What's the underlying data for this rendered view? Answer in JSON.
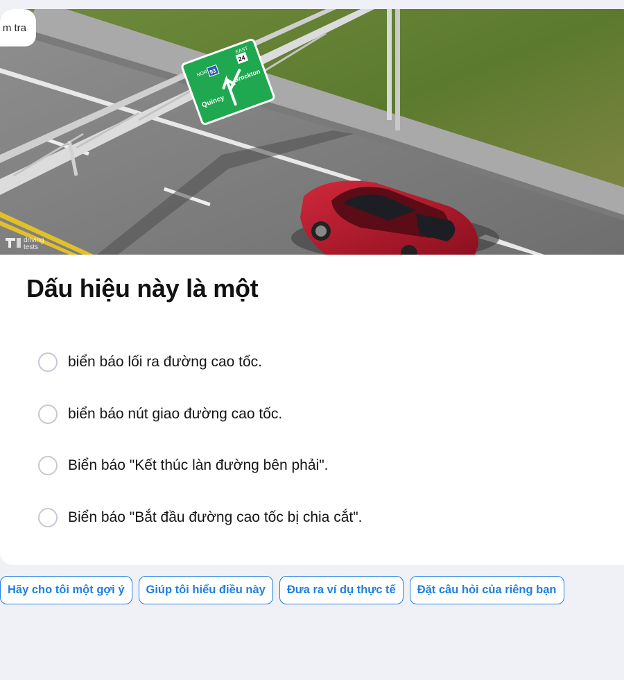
{
  "badge": {
    "text": "m tra"
  },
  "image": {
    "sign": {
      "north_label": "NORTH",
      "route_93": "93",
      "east_label": "EAST",
      "route_24": "24",
      "left_destination": "Quincy",
      "right_destination": "Brockton"
    },
    "watermark": {
      "line1": "driving",
      "line2": "tests"
    }
  },
  "question": {
    "title": "Dấu hiệu này là một"
  },
  "options": [
    {
      "label": "biển báo lối ra đường cao tốc."
    },
    {
      "label": "biển báo nút giao đường cao tốc."
    },
    {
      "label": "Biển báo \"Kết thúc làn đường bên phải\"."
    },
    {
      "label": "Biển báo \"Bắt đầu đường cao tốc bị chia cắt\"."
    }
  ],
  "actions": [
    {
      "label": "Hãy cho tôi một gợi ý"
    },
    {
      "label": "Giúp tôi hiểu điều này"
    },
    {
      "label": "Đưa ra ví dụ thực tế"
    },
    {
      "label": "Đặt câu hỏi của riêng bạn"
    }
  ],
  "colors": {
    "accent": "#1f7fe0",
    "page_bg": "#f0f1f6",
    "sign_green": "#1fa84f",
    "car_red": "#b3172a"
  }
}
